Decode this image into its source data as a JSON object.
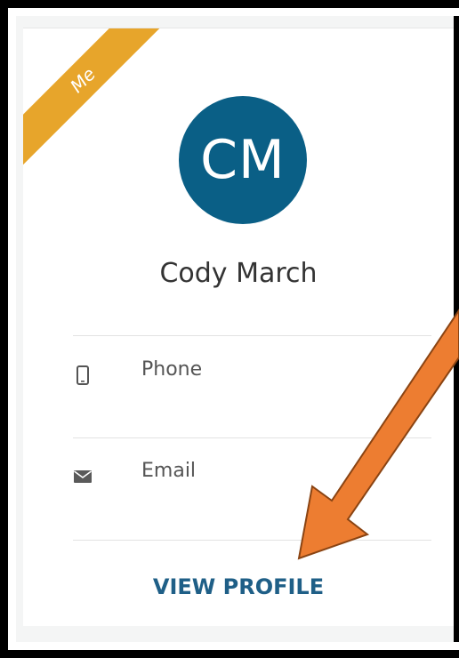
{
  "card": {
    "ribbon_label": "Me",
    "avatar_initials": "CM",
    "name": "Cody March",
    "phone_label": "Phone",
    "email_label": "Email",
    "view_profile_label": "VIEW PROFILE"
  },
  "colors": {
    "ribbon": "#e7a52b",
    "avatar": "#0a5f86",
    "link": "#1f5f87",
    "arrow": "#ed7d31"
  },
  "icons": {
    "phone": "phone-icon",
    "email": "envelope-icon",
    "arrow": "arrow-annotation-icon"
  }
}
